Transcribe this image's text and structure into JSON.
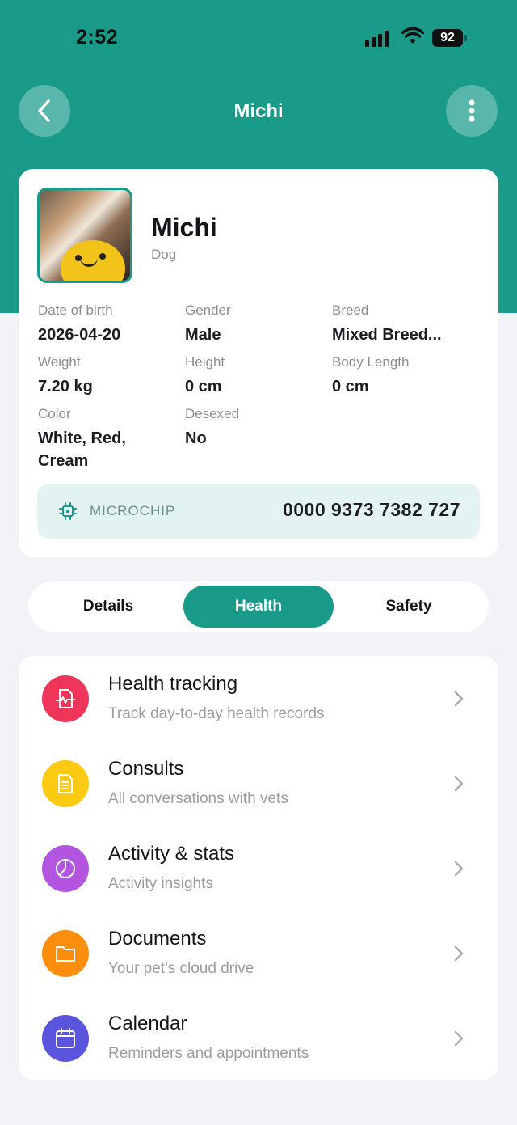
{
  "status_bar": {
    "time": "2:52",
    "battery": "92"
  },
  "header": {
    "title": "Michi"
  },
  "profile": {
    "name": "Michi",
    "species": "Dog",
    "attributes": [
      {
        "label": "Date of birth",
        "value": "2026-04-20"
      },
      {
        "label": "Gender",
        "value": "Male"
      },
      {
        "label": "Breed",
        "value": "Mixed Breed..."
      },
      {
        "label": "Weight",
        "value": "7.20 kg"
      },
      {
        "label": "Height",
        "value": "0 cm"
      },
      {
        "label": "Body Length",
        "value": "0 cm"
      },
      {
        "label": "Color",
        "value": "White, Red, Cream"
      },
      {
        "label": "Desexed",
        "value": "No"
      }
    ],
    "microchip": {
      "label": "MICROCHIP",
      "number": "0000 9373 7382 727"
    }
  },
  "tabs": [
    {
      "label": "Details",
      "active": false
    },
    {
      "label": "Health",
      "active": true
    },
    {
      "label": "Safety",
      "active": false
    }
  ],
  "menu": [
    {
      "title": "Health tracking",
      "subtitle": "Track day-to-day health records",
      "icon": "health-record-icon",
      "color": "#f0355a"
    },
    {
      "title": "Consults",
      "subtitle": "All conversations with vets",
      "icon": "document-icon",
      "color": "#fcc913"
    },
    {
      "title": "Activity & stats",
      "subtitle": "Activity insights",
      "icon": "pie-chart-icon",
      "color": "#b355e0"
    },
    {
      "title": "Documents",
      "subtitle": "Your pet's cloud drive",
      "icon": "folder-icon",
      "color": "#fb8f0d"
    },
    {
      "title": "Calendar",
      "subtitle": "Reminders and appointments",
      "icon": "calendar-icon",
      "color": "#5a55dc"
    }
  ],
  "colors": {
    "brand": "#1a9a89",
    "chip_bg": "#e3f3f1",
    "page_bg": "#f2f3f7"
  }
}
